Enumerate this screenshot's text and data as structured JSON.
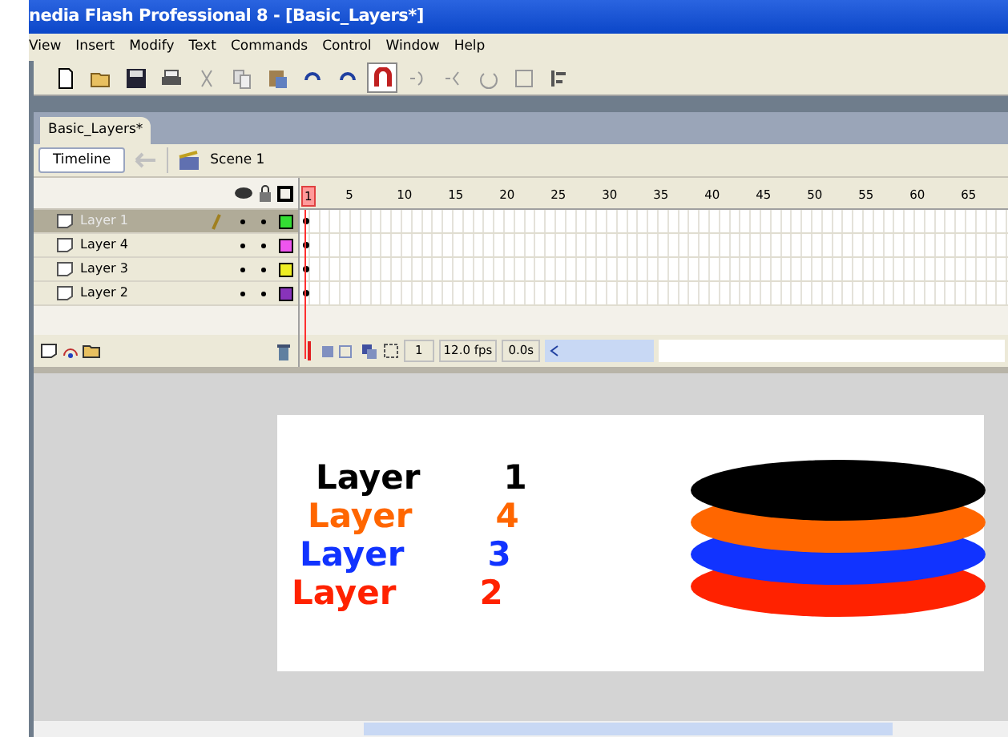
{
  "window": {
    "title": "nedia Flash Professional 8 - [Basic_Layers*]"
  },
  "menu": [
    "View",
    "Insert",
    "Modify",
    "Text",
    "Commands",
    "Control",
    "Window",
    "Help"
  ],
  "toolbar": {
    "snap_pressed": true
  },
  "document_tab": {
    "label": "Basic_Layers*"
  },
  "edit_bar": {
    "timeline_button": "Timeline",
    "back_disabled": true,
    "scene": "Scene 1"
  },
  "layers": [
    {
      "name": "Layer 1",
      "selected": true,
      "editing": true,
      "color": "#33dd33"
    },
    {
      "name": "Layer 4",
      "selected": false,
      "editing": false,
      "color": "#ee55ee"
    },
    {
      "name": "Layer 3",
      "selected": false,
      "editing": false,
      "color": "#eeee22"
    },
    {
      "name": "Layer 2",
      "selected": false,
      "editing": false,
      "color": "#8833bb"
    }
  ],
  "ruler": [
    "1",
    "5",
    "10",
    "15",
    "20",
    "25",
    "30",
    "35",
    "40",
    "45",
    "50",
    "55",
    "60",
    "65"
  ],
  "status": {
    "frame": "1",
    "fps": "12.0 fps",
    "time": "0.0s"
  },
  "stage_texts": [
    {
      "word": "Layer",
      "number": "1",
      "color": "#000000"
    },
    {
      "word": "Layer",
      "number": "4",
      "color": "#ff6600"
    },
    {
      "word": "Layer",
      "number": "3",
      "color": "#1133ff"
    },
    {
      "word": "Layer",
      "number": "2",
      "color": "#ff2200"
    }
  ],
  "stage_shapes": [
    {
      "color": "#000000"
    },
    {
      "color": "#ff6600"
    },
    {
      "color": "#1133ff"
    },
    {
      "color": "#ff2200"
    }
  ]
}
